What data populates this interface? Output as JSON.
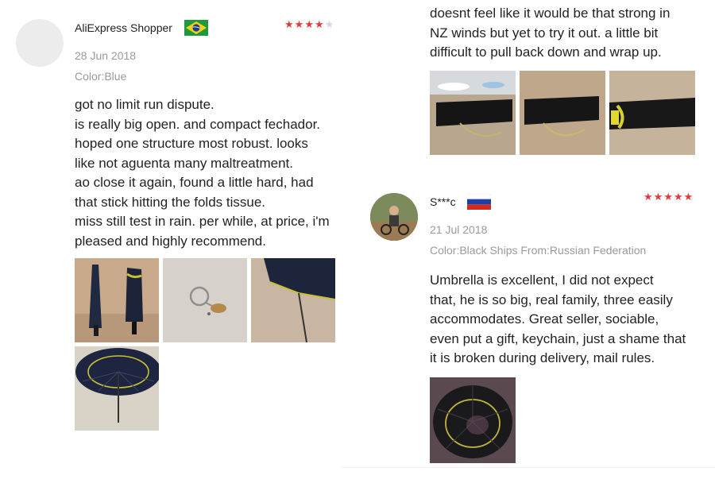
{
  "left_review": {
    "reviewer_name": "AliExpress Shopper",
    "country_flag": "brazil-flag-icon",
    "rating": 4,
    "rating_max": 5,
    "date": "28 Jun 2018",
    "attributes": "Color:Blue",
    "text_lines": [
      "got no limit run dispute.",
      "is really big open. and compact fechador.",
      "hoped one structure most robust. looks",
      "like not aguenta many maltreatment.",
      "ao close it again, found a little hard, had",
      "that stick hitting the folds tissue.",
      "miss still test in rain. per while, at price, i'm",
      "pleased and highly recommend."
    ],
    "photo_count": 4
  },
  "right_top_review": {
    "text_lines": [
      "doesnt feel like it would be that strong in",
      "NZ winds but yet to try it out. a little bit",
      "difficult to pull back down and wrap up."
    ],
    "photo_count": 3
  },
  "right_review": {
    "reviewer_name": "S***c",
    "country_flag": "russia-flag-icon",
    "rating": 5,
    "rating_max": 5,
    "date": "21 Jul 2018",
    "attributes": "Color:Black Ships From:Russian Federation",
    "text_lines": [
      "Umbrella is excellent, I did not expect",
      "that, he is so big, real family, three easily",
      "accommodates. Great seller, sociable,",
      "even put a gift, keychain, just a shame that",
      "it is broken during delivery, mail rules."
    ],
    "photo_count": 1
  },
  "colors": {
    "star_active": "#e4393c",
    "star_inactive": "#d7d7d7",
    "meta_text": "#9a9a9a"
  }
}
